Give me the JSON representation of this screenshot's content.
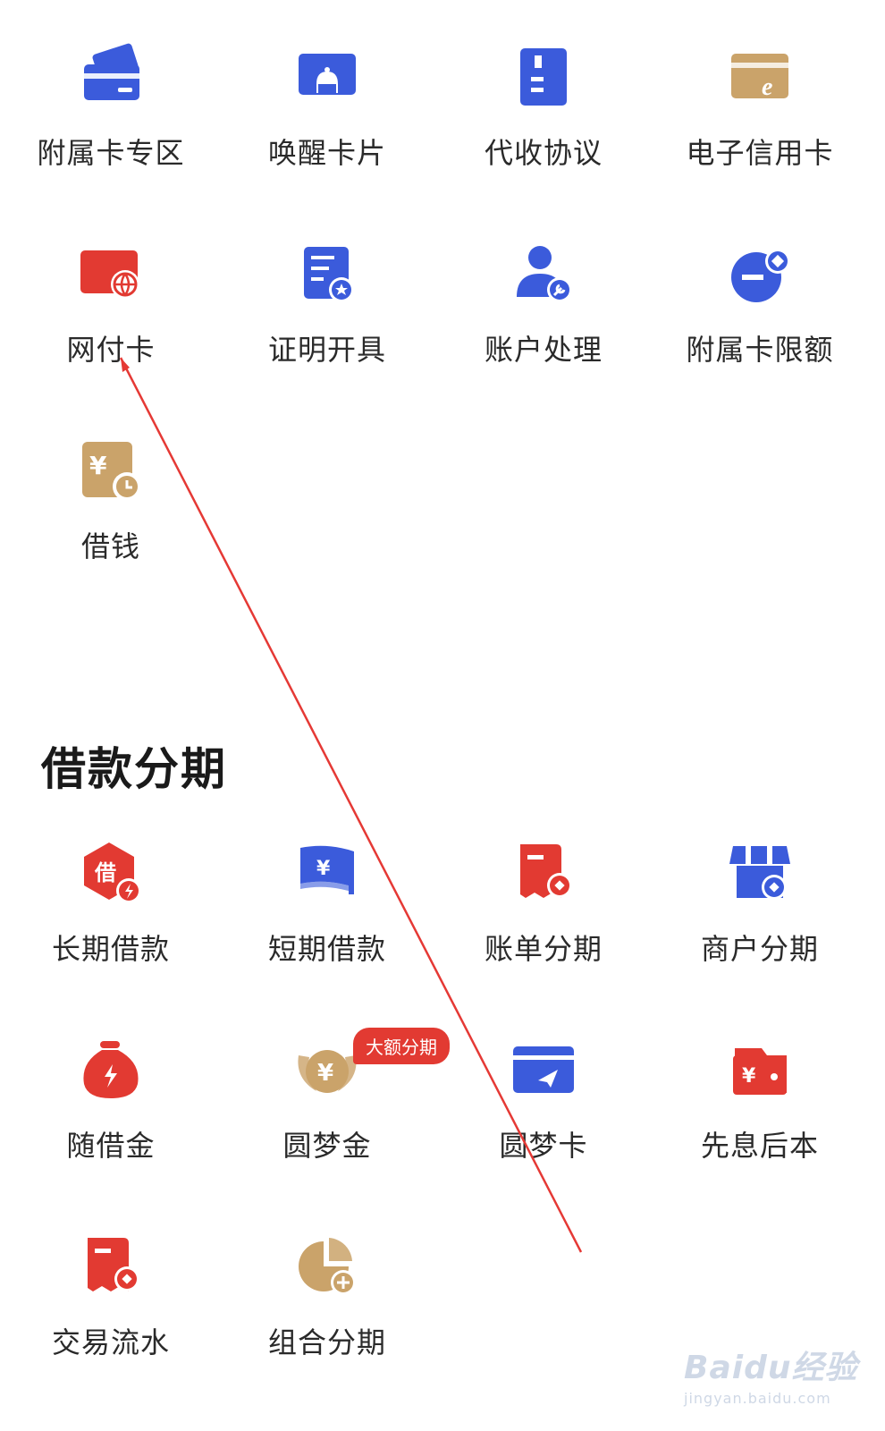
{
  "colors": {
    "blue": "#3b5bdb",
    "gold": "#caa36a",
    "red": "#e23a32",
    "accent_arrow": "#e53935"
  },
  "top_items": [
    {
      "label": "附属卡专区",
      "icon": "card-icon"
    },
    {
      "label": "唤醒卡片",
      "icon": "bell-card-icon"
    },
    {
      "label": "代收协议",
      "icon": "document-icon"
    },
    {
      "label": "电子信用卡",
      "icon": "e-card-icon"
    },
    {
      "label": "网付卡",
      "icon": "globe-card-icon"
    },
    {
      "label": "证明开具",
      "icon": "certificate-icon"
    },
    {
      "label": "账户处理",
      "icon": "user-wrench-icon"
    },
    {
      "label": "附属卡限额",
      "icon": "limit-icon"
    },
    {
      "label": "借钱",
      "icon": "yuan-clock-icon"
    }
  ],
  "section": {
    "title": "借款分期"
  },
  "loan_items": [
    {
      "label": "长期借款",
      "icon": "borrow-hex-icon"
    },
    {
      "label": "短期借款",
      "icon": "yuan-flag-icon"
    },
    {
      "label": "账单分期",
      "icon": "bill-icon"
    },
    {
      "label": "商户分期",
      "icon": "store-icon"
    },
    {
      "label": "随借金",
      "icon": "money-bag-icon"
    },
    {
      "label": "圆梦金",
      "icon": "yuan-wreath-icon"
    },
    {
      "label": "圆梦卡",
      "icon": "send-card-icon"
    },
    {
      "label": "先息后本",
      "icon": "wallet-icon"
    },
    {
      "label": "交易流水",
      "icon": "transaction-icon"
    },
    {
      "label": "组合分期",
      "icon": "pie-icon"
    }
  ],
  "badge": {
    "text": "大额分期"
  },
  "watermark": {
    "brand": "Baidu经验",
    "url": "jingyan.baidu.com"
  }
}
